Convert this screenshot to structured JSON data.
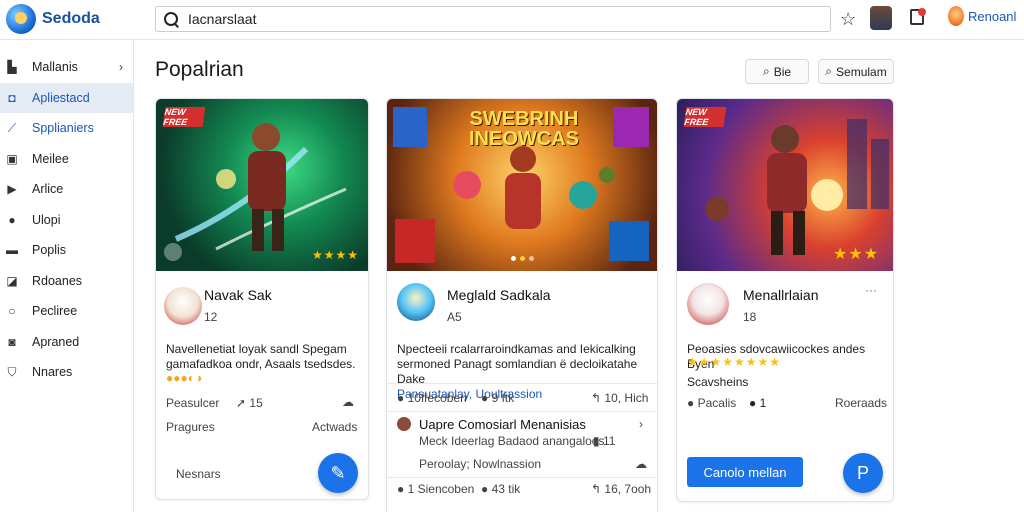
{
  "app": {
    "name": "Sedoda"
  },
  "search": {
    "value": "Iacnarslaat"
  },
  "header": {
    "user_name": "Renoanl"
  },
  "sidebar": {
    "items": [
      {
        "label": "Mallanis",
        "icon": "building-icon"
      },
      {
        "label": "Apliestacd",
        "icon": "app-icon"
      },
      {
        "label": "Spplianiers",
        "icon": "spark-icon"
      },
      {
        "label": "Meilee",
        "icon": "media-icon"
      },
      {
        "label": "Arlice",
        "icon": "play-icon"
      },
      {
        "label": "Ulopi",
        "icon": "user-icon"
      },
      {
        "label": "Poplis",
        "icon": "folder-icon"
      },
      {
        "label": "Rdoanes",
        "icon": "tag-icon"
      },
      {
        "label": "Pecliree",
        "icon": "circle-icon"
      },
      {
        "label": "Apraned",
        "icon": "chat-icon"
      },
      {
        "label": "Nnares",
        "icon": "shield-icon"
      }
    ]
  },
  "main": {
    "title": "Popalrian",
    "btn_sort": "Bie",
    "btn_search": "Semulam"
  },
  "cards": [
    {
      "badge": "NEW FREE",
      "title": "Navak Sak",
      "sub": "12",
      "desc1": "Navellenetiat loyak sandl Spegam",
      "desc2": "gamafadkoa ondr, Asaals tsedsdes.",
      "meta1": "Peasulcer",
      "meta2": "15",
      "link_left": "Pragures",
      "link_right": "Actwads",
      "footer_link": "Nesnars"
    },
    {
      "banner": "SWEBRINH INEOWCAS",
      "title": "Meglald Sadkala",
      "sub": "A5",
      "desc1": "Npecteeii rcalarraroindkamas and Iekicalking",
      "desc2": "sermoned Panagt somlandian ë decloikatahe Dake",
      "desc_link": "Pansuatanlay, Uoultrassion",
      "row1_left": "10ffecoben",
      "row1_mid": "9 ftk",
      "row1_right": "10, Hich",
      "row2_title": "Uapre Comosiarl  Menanisias",
      "row2_sub": "Meck Ideerlag Badaod anangaloes",
      "row2_num": "11",
      "row2_link": "Peroolay; Nowlnassion",
      "row3_left": "1 Siencoben",
      "row3_mid": "43 tik",
      "row3_right": "16, 7ooh"
    },
    {
      "badge": "NEW FREE",
      "title": "Menallrlaian",
      "sub": "18",
      "desc1": "Peoasies sdovcawiicockes andes Byen",
      "subtext": "Scavsheins",
      "meta1": "Pacalis",
      "meta2": "1",
      "link_right": "Roeraads",
      "primary_button": "Canolo mellan",
      "fab_label": "P"
    }
  ]
}
